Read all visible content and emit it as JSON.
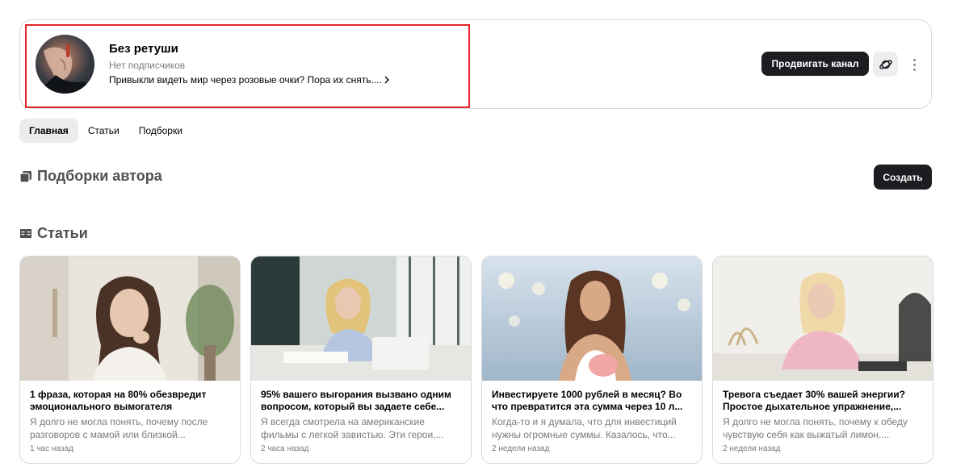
{
  "channel": {
    "title": "Без ретуши",
    "subscribers": "Нет подписчиков",
    "description": "Привыкли видеть мир через розовые очки? Пора их снять....",
    "promote_label": "Продвигать канал",
    "highlight_color": "#e3262b"
  },
  "tabs": [
    {
      "label": "Главная",
      "active": true
    },
    {
      "label": "Статьи",
      "active": false
    },
    {
      "label": "Подборки",
      "active": false
    }
  ],
  "collections": {
    "title": "Подборки автора",
    "create_label": "Создать"
  },
  "articles": {
    "title": "Статьи",
    "items": [
      {
        "title": "1 фраза, которая на 80% обезвредит эмоционального вымогателя",
        "excerpt": "Я долго не могла понять, почему после разговоров с мамой или близкой...",
        "time": "1 час назад"
      },
      {
        "title": "95% вашего выгорания вызвано одним вопросом, который вы задаете себе...",
        "excerpt": "Я всегда смотрела на американские фильмы с легкой завистью. Эти герои,...",
        "time": "2 часа назад"
      },
      {
        "title": "Инвестируете 1000 рублей в месяц? Во что превратится эта сумма через 10 л...",
        "excerpt": "Когда-то и я думала, что для инвестиций нужны огромные суммы. Казалось, что...",
        "time": "2 недели назад"
      },
      {
        "title": "Тревога съедает 30% вашей энергии? Простое дыхательное упражнение,...",
        "excerpt": "Я долго не могла понять, почему к обеду чувствую себя как выжатый лимон....",
        "time": "2 недели назад"
      }
    ]
  },
  "colors": {
    "accent_dark": "#1c1d21",
    "muted_text": "#7a7a80",
    "heading_text": "#505055"
  }
}
